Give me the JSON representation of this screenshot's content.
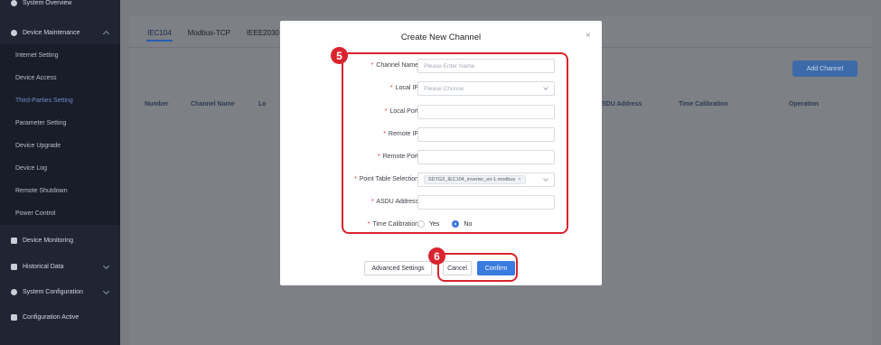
{
  "sidebar": {
    "items": [
      {
        "label": "System Overview",
        "icon": "dashboard-icon",
        "type": "top"
      },
      {
        "label": "Device Maintenance",
        "icon": "shield-icon",
        "type": "top",
        "expanded": true
      },
      {
        "label": "Internet Setting",
        "type": "sub"
      },
      {
        "label": "Device Access",
        "type": "sub"
      },
      {
        "label": "Third-Parties Setting",
        "type": "sub",
        "active": true
      },
      {
        "label": "Parameter Setting",
        "type": "sub"
      },
      {
        "label": "Device Upgrade",
        "type": "sub"
      },
      {
        "label": "Device Log",
        "type": "sub"
      },
      {
        "label": "Remote Shutdown",
        "type": "sub"
      },
      {
        "label": "Power Control",
        "type": "sub"
      },
      {
        "label": "Device Monitoring",
        "icon": "monitor-icon",
        "type": "top"
      },
      {
        "label": "Historical Data",
        "icon": "chart-icon",
        "type": "top",
        "expandable": true
      },
      {
        "label": "System Configuration",
        "icon": "gear-icon",
        "type": "top",
        "expandable": true
      },
      {
        "label": "Configuration Active",
        "icon": "config-icon",
        "type": "top"
      }
    ]
  },
  "tabs": [
    "IEC104",
    "Modbus-TCP",
    "IEEE2030"
  ],
  "active_tab": "IEC104",
  "add_channel_label": "Add Channel",
  "table": {
    "headers": [
      "Number",
      "Channel Name",
      "Lo",
      "SDU Address",
      "Time Calibration",
      "Operation"
    ]
  },
  "modal": {
    "title": "Create New Channel",
    "close": "×",
    "fields": {
      "channel_name": {
        "label": "Channel Name",
        "placeholder": "Please Enter Name"
      },
      "local_ip": {
        "label": "Local IP",
        "placeholder": "Please Choose"
      },
      "local_port": {
        "label": "Local Port",
        "value": ""
      },
      "remote_ip": {
        "label": "Remote IP",
        "value": ""
      },
      "remote_port": {
        "label": "Remote Port",
        "value": ""
      },
      "point_table": {
        "label": "Point Table Selection",
        "value": "SDTG3_IEC104_inverter_en-1.modbus",
        "remove": "×"
      },
      "asdu_address": {
        "label": "ASDU Address",
        "value": ""
      },
      "time_calibration": {
        "label": "Time Calibration",
        "options": [
          "Yes",
          "No"
        ],
        "selected": "No"
      }
    },
    "buttons": {
      "advanced": "Advanced Settings",
      "cancel": "Cancel",
      "confirm": "Confirm"
    }
  },
  "annotations": {
    "badge_5": "5",
    "badge_6": "6"
  },
  "colors": {
    "annotation_red": "#d9232e",
    "primary_blue": "#3a7be0",
    "required_star": "#e0332a"
  }
}
